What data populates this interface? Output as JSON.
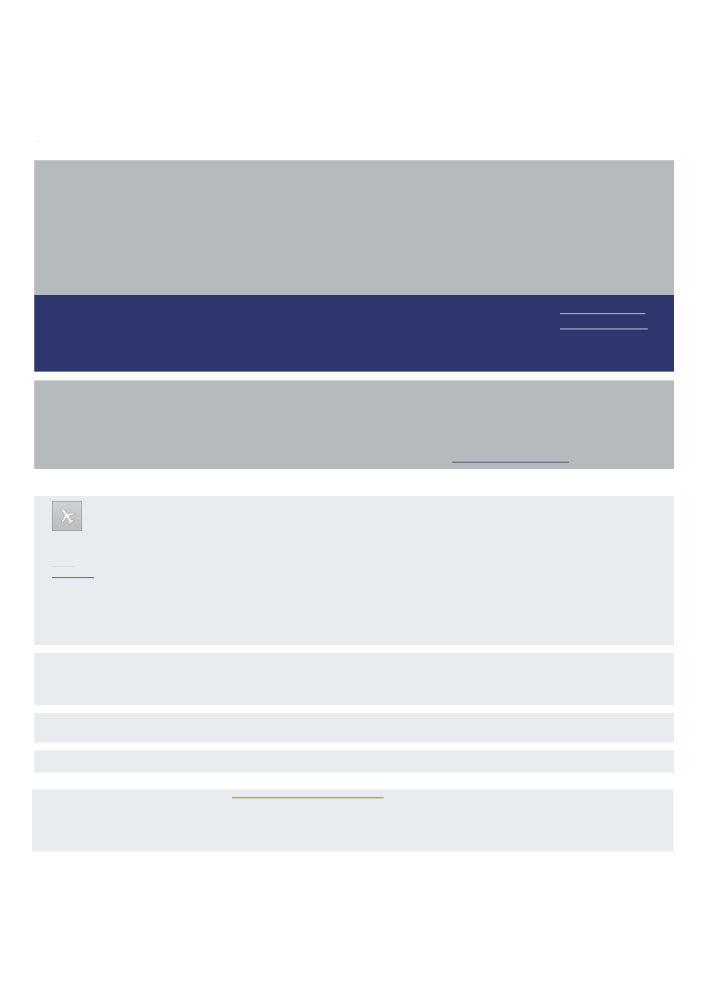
{
  "page": {
    "top_mark": "···"
  },
  "header": {
    "banner_top": {
      "color": "#b5babc"
    },
    "banner_nav": {
      "color": "#2d376e",
      "links": [
        {
          "label": ""
        },
        {
          "label": ""
        }
      ]
    }
  },
  "notice": {
    "color": "#b5babc",
    "link": {
      "label": ""
    }
  },
  "flight_panel": {
    "color": "#e9ecee",
    "icon": "airplane-icon",
    "link": {
      "label": ""
    }
  },
  "info_panels": [
    {
      "color": "#e9ecee"
    },
    {
      "color": "#e9ecee"
    },
    {
      "color": "#e9ecee"
    }
  ],
  "footer_panel": {
    "color": "#e9ecee",
    "link": {
      "label": "",
      "color": "#b0462a"
    }
  }
}
